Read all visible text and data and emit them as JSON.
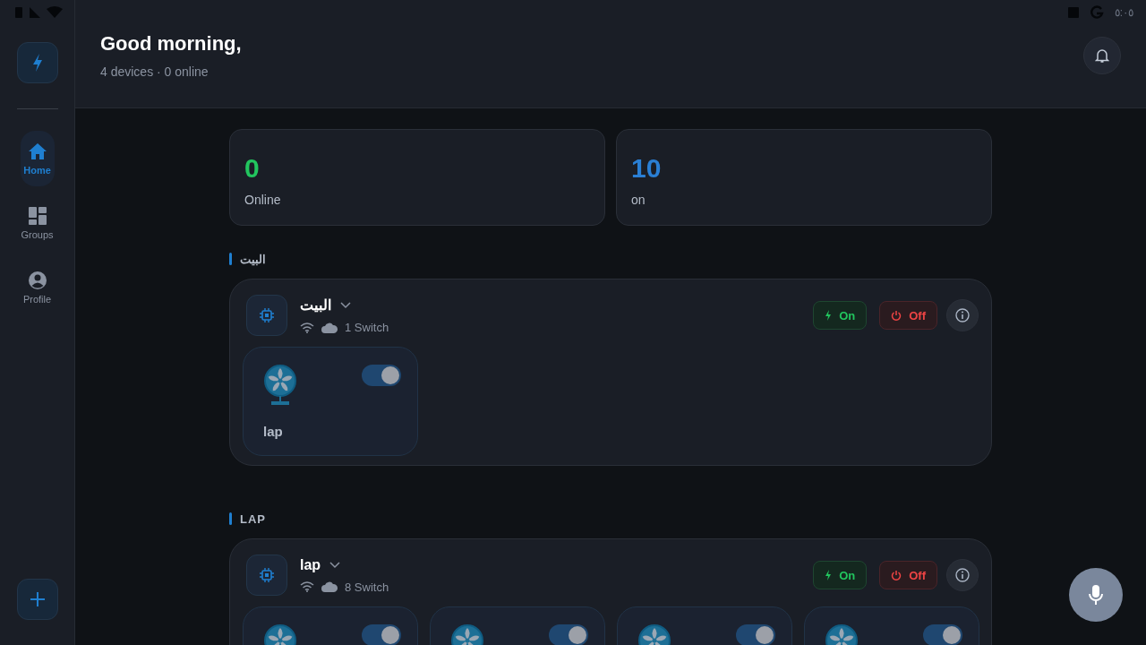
{
  "status_bar": {
    "time": "٥:٠٥"
  },
  "sidebar": {
    "items": [
      {
        "label": "Home",
        "kind": "home",
        "selected": true
      },
      {
        "label": "Groups",
        "kind": "groups",
        "selected": false
      },
      {
        "label": "Profile",
        "kind": "profile",
        "selected": false
      }
    ]
  },
  "header": {
    "title": "Good morning,",
    "subtitle": "4 devices · 0 online"
  },
  "stats": [
    {
      "value": "0",
      "label": "Online",
      "color": "#22c55e"
    },
    {
      "value": "10",
      "label": "on",
      "color": "#2a7fd4"
    }
  ],
  "groups": [
    {
      "section": "البيت",
      "name": "البيت",
      "count": "1 Switch",
      "on_label": "On",
      "off_label": "Off",
      "devices": [
        {
          "name": "lap",
          "on": true
        }
      ]
    },
    {
      "section": "LAP",
      "name": "lap",
      "count": "8 Switch",
      "on_label": "On",
      "off_label": "Off",
      "devices": [
        {
          "on": true
        },
        {
          "on": true
        },
        {
          "on": true
        },
        {
          "on": true
        }
      ]
    }
  ]
}
